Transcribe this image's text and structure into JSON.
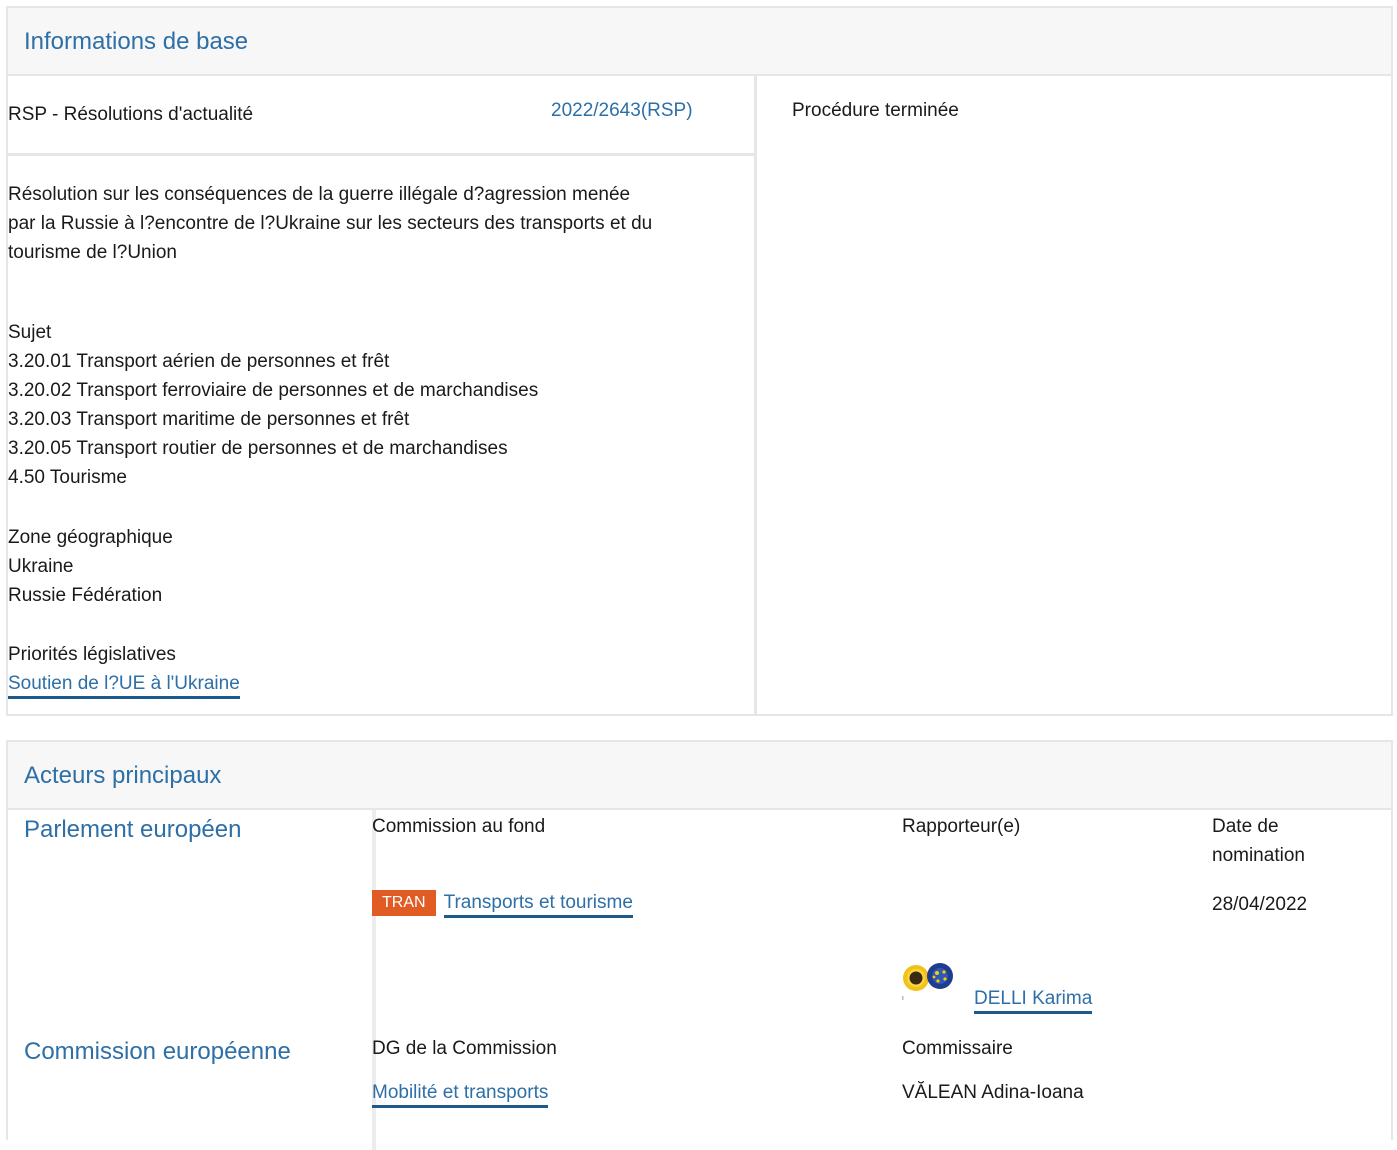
{
  "basic_info": {
    "header": "Informations de base",
    "procedure_type": "RSP - Résolutions d'actualité",
    "procedure_ref": "2022/2643(RSP)",
    "status": "Procédure terminée",
    "title_lines": [
      "Résolution sur les conséquences de la guerre illégale d?agression menée",
      "par la Russie à l?encontre de l?Ukraine sur les secteurs des transports et du",
      "tourisme de l?Union"
    ],
    "subject_label": "Sujet",
    "subjects": [
      "3.20.01 Transport aérien de personnes et frêt",
      "3.20.02 Transport ferroviaire de personnes et de marchandises",
      "3.20.03 Transport maritime de personnes et frêt",
      "3.20.05 Transport routier de personnes et de marchandises",
      "4.50 Tourisme"
    ],
    "geo_label": "Zone géographique",
    "geo": [
      "Ukraine",
      "Russie Fédération"
    ],
    "priority_label": "Priorités législatives",
    "priority_link": "Soutien de l?UE à l'Ukraine"
  },
  "actors": {
    "header": "Acteurs principaux",
    "parliament": {
      "label": "Parlement européen",
      "committee_header": "Commission au fond",
      "rapporteur_header": "Rapporteur(e)",
      "date_header_line1": "Date de",
      "date_header_line2": "nomination",
      "committee_tag": "TRAN",
      "committee_name": "Transports et tourisme",
      "date": "28/04/2022",
      "rapporteur_name": "DELLI Karima"
    },
    "commission": {
      "label": "Commission européenne",
      "dg_header": "DG de la Commission",
      "commissioner_header": "Commissaire",
      "dg_name": "Mobilité et transports",
      "commissioner_name": "VĂLEAN Adina-Ioana"
    }
  },
  "colors": {
    "link": "#2d6fa6",
    "tag": "#e15b25",
    "border": "#e6e6e6"
  }
}
